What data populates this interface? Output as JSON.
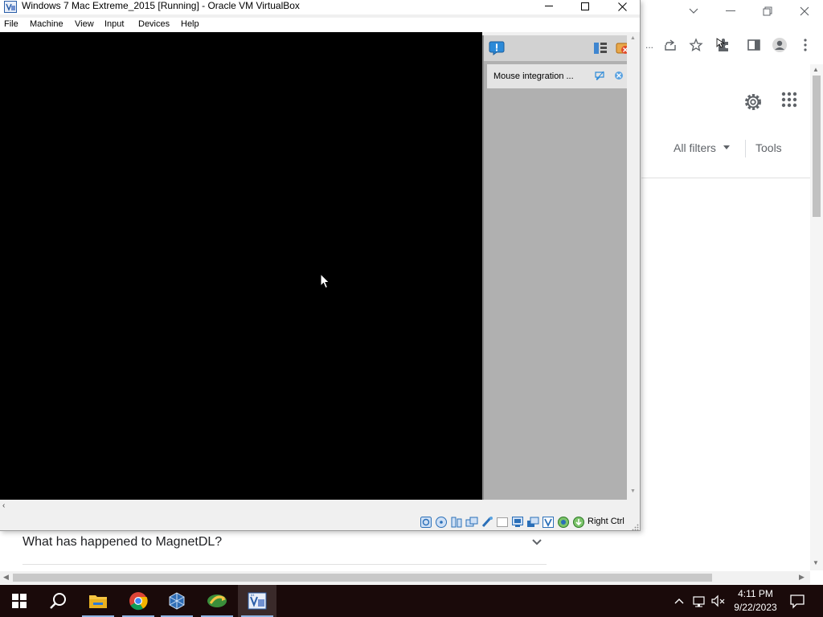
{
  "vbox": {
    "title": "Windows 7 Mac Extreme_2015 [Running] - Oracle VM VirtualBox",
    "menu": [
      "File",
      "Machine",
      "View",
      "Input",
      "Devices",
      "Help"
    ],
    "notification": "Mouse integration ...",
    "host_key": "Right Ctrl",
    "status_icons": [
      "hard-disk-icon",
      "optical-drive-icon",
      "audio-icon",
      "network-icon",
      "usb-icon",
      "shared-folder-icon",
      "display-icon",
      "recording-icon",
      "vt-x-icon",
      "mouse-integration-icon",
      "keyboard-capture-icon"
    ]
  },
  "browser": {
    "all_filters": "All filters",
    "tools": "Tools",
    "faq_question": "What has happened to MagnetDL?",
    "toolbar_overflow": "..."
  },
  "taskbar": {
    "apps": [
      "start-icon",
      "search-icon",
      "file-explorer-icon",
      "chrome-icon",
      "virtualbox-icon",
      "idm-icon",
      "vbox-vm-icon"
    ],
    "time": "4:11 PM",
    "date": "9/22/2023"
  },
  "colors": {
    "taskbar": "#1a0a0a",
    "vm_screen": "#000000",
    "accent": "#1e73c8"
  }
}
